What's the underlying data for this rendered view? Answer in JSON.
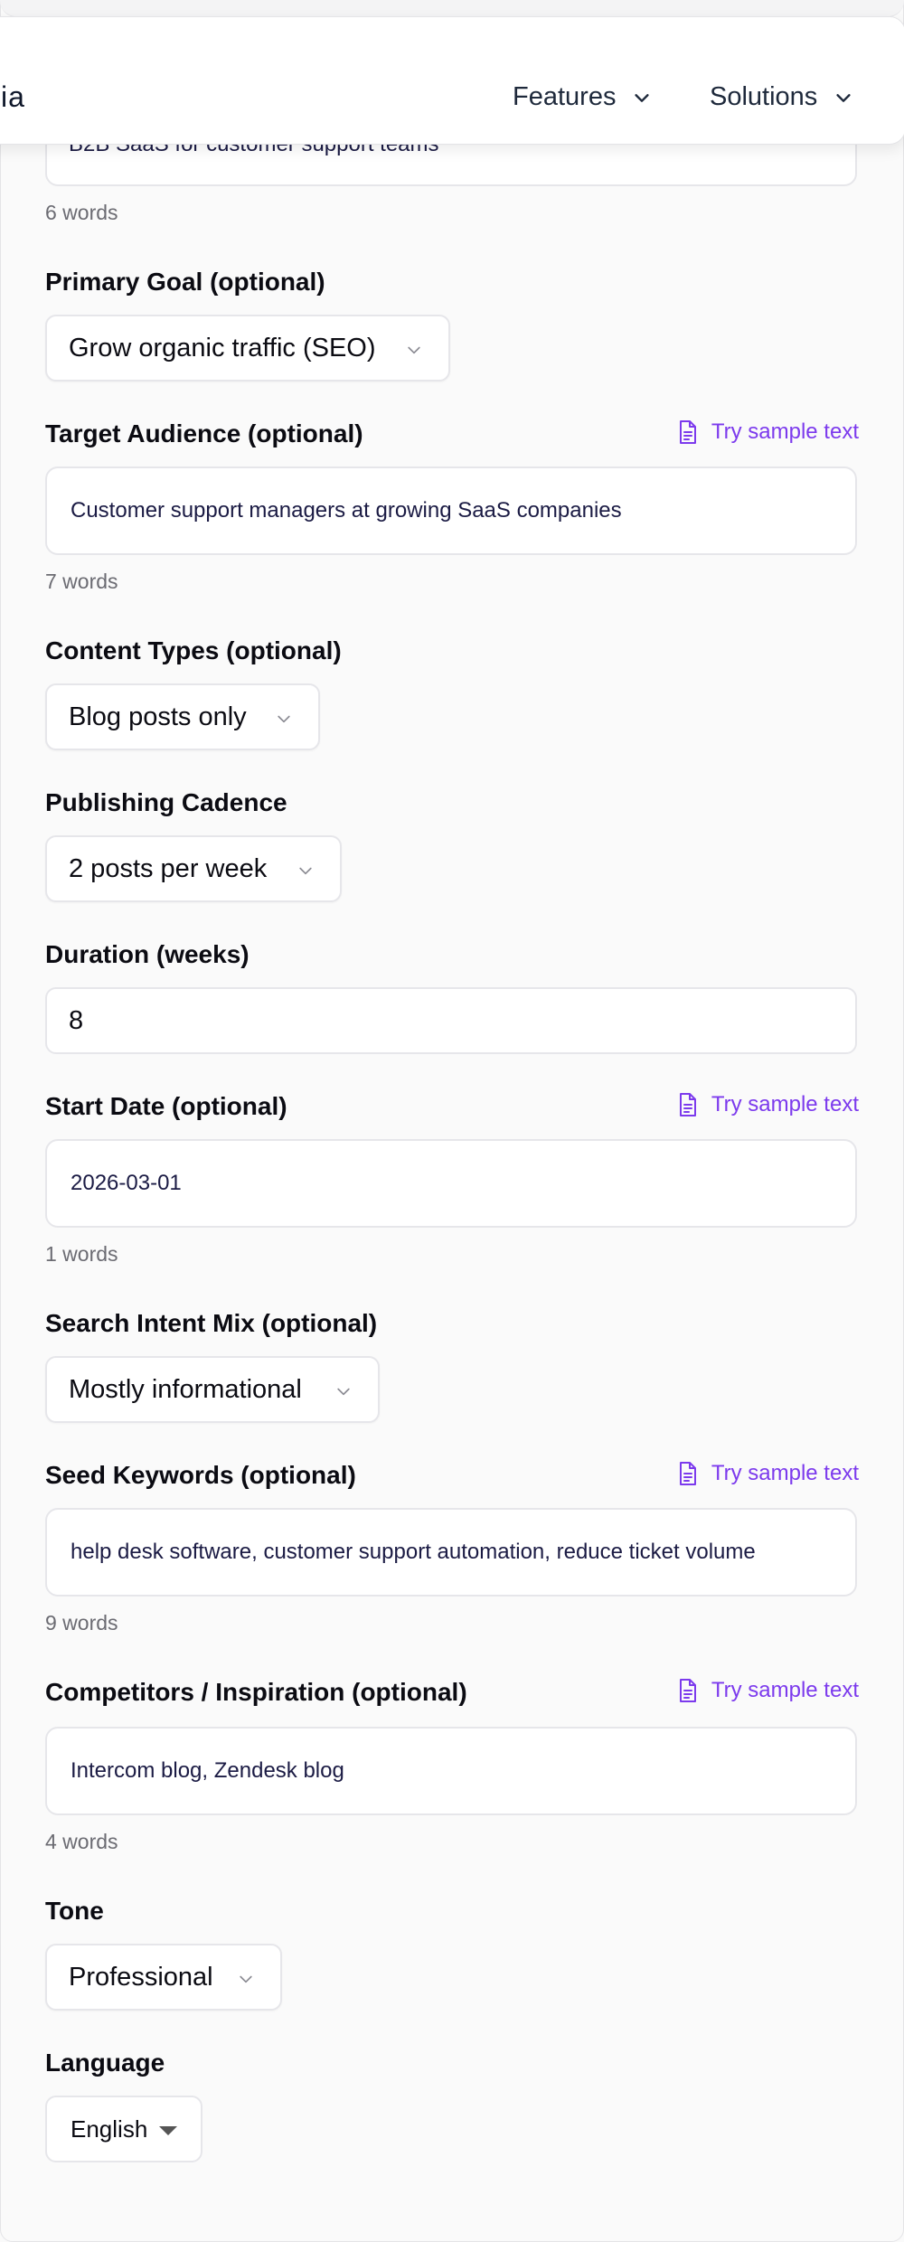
{
  "navbar": {
    "brand_fragment": "ia",
    "items": [
      {
        "label": "Features"
      },
      {
        "label": "Solutions"
      }
    ]
  },
  "form": {
    "sample_link_label": "Try sample text",
    "product": {
      "value": "B2B SaaS for customer support teams",
      "count": "6 words"
    },
    "primary_goal": {
      "label": "Primary Goal (optional)",
      "value": "Grow organic traffic (SEO)"
    },
    "target_audience": {
      "label": "Target Audience (optional)",
      "value": "Customer support managers at growing SaaS companies",
      "count": "7 words"
    },
    "content_types": {
      "label": "Content Types (optional)",
      "value": "Blog posts only"
    },
    "publishing_cadence": {
      "label": "Publishing Cadence",
      "value": "2 posts per week"
    },
    "duration": {
      "label": "Duration (weeks)",
      "value": "8"
    },
    "start_date": {
      "label": "Start Date (optional)",
      "value": "2026-03-01",
      "count": "1 words"
    },
    "search_intent": {
      "label": "Search Intent Mix (optional)",
      "value": "Mostly informational"
    },
    "seed_keywords": {
      "label": "Seed Keywords (optional)",
      "value": "help desk software, customer support automation, reduce ticket volume",
      "count": "9 words"
    },
    "competitors": {
      "label": "Competitors / Inspiration (optional)",
      "value": "Intercom blog, Zendesk blog",
      "count": "4 words"
    },
    "tone": {
      "label": "Tone",
      "value": "Professional"
    },
    "language": {
      "label": "Language",
      "value": "English"
    }
  },
  "colors": {
    "accent": "#7c3aed",
    "page_background": "#fafafa",
    "field_border": "#e6e6ea"
  }
}
